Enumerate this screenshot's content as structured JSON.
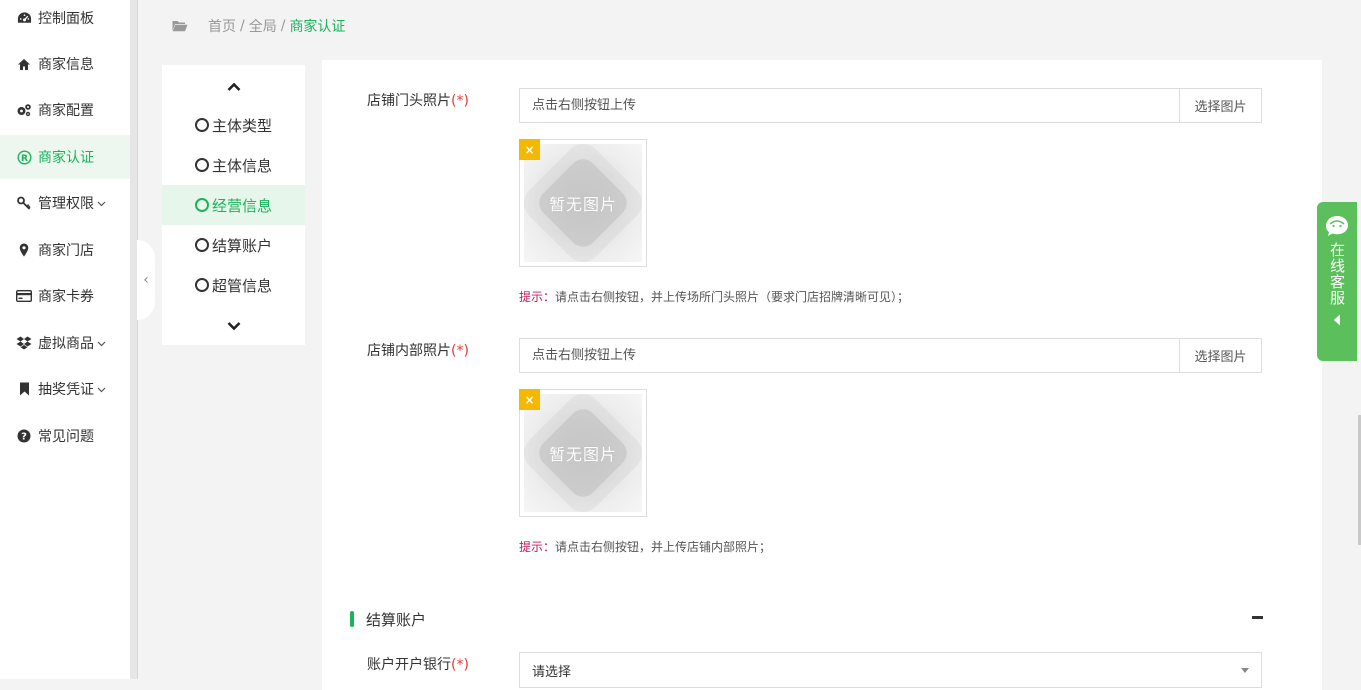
{
  "sidebar": {
    "items": [
      {
        "label": "控制面板",
        "icon": "dashboard-icon",
        "has_caret": false
      },
      {
        "label": "商家信息",
        "icon": "home-icon",
        "has_caret": false
      },
      {
        "label": "商家配置",
        "icon": "gears-icon",
        "has_caret": false
      },
      {
        "label": "商家认证",
        "icon": "registered-icon",
        "has_caret": false,
        "active": true
      },
      {
        "label": "管理权限",
        "icon": "key-icon",
        "has_caret": true
      },
      {
        "label": "商家门店",
        "icon": "map-pin-icon",
        "has_caret": false
      },
      {
        "label": "商家卡券",
        "icon": "card-icon",
        "has_caret": false
      },
      {
        "label": "虚拟商品",
        "icon": "dropbox-icon",
        "has_caret": true
      },
      {
        "label": "抽奖凭证",
        "icon": "bookmark-icon",
        "has_caret": true
      },
      {
        "label": "常见问题",
        "icon": "question-circle-icon",
        "has_caret": false
      }
    ],
    "collapse_glyph": "‹"
  },
  "breadcrumb": {
    "home": "首页",
    "global": "全局",
    "current": "商家认证",
    "separator": "/"
  },
  "steps": {
    "items": [
      {
        "label": "主体类型"
      },
      {
        "label": "主体信息"
      },
      {
        "label": "经营信息",
        "active": true
      },
      {
        "label": "结算账户"
      },
      {
        "label": "超管信息"
      }
    ]
  },
  "form": {
    "storefront": {
      "label": "店铺门头照片",
      "required_mark": "(*)",
      "placeholder": "点击右侧按钮上传",
      "button": "选择图片",
      "thumb_text": "暂无图片",
      "remove_glyph": "×",
      "hint_label": "提示：",
      "hint_text": "请点击右侧按钮，并上传场所门头照片（要求门店招牌清晰可见）；"
    },
    "interior": {
      "label": "店铺内部照片",
      "required_mark": "(*)",
      "placeholder": "点击右侧按钮上传",
      "button": "选择图片",
      "thumb_text": "暂无图片",
      "remove_glyph": "×",
      "hint_label": "提示：",
      "hint_text": "请点击右侧按钮，并上传店铺内部照片；"
    },
    "settlement_section": {
      "title": "结算账户"
    },
    "bank": {
      "label": "账户开户银行",
      "required_mark": "(*)",
      "selected": "请选择"
    }
  },
  "service": {
    "label": "在线客服"
  },
  "colors": {
    "accent": "#1ab35b",
    "required": "#e23b3b",
    "hint": "#c2185b",
    "remove_badge": "#f5b800",
    "service": "#5bbf5b"
  }
}
